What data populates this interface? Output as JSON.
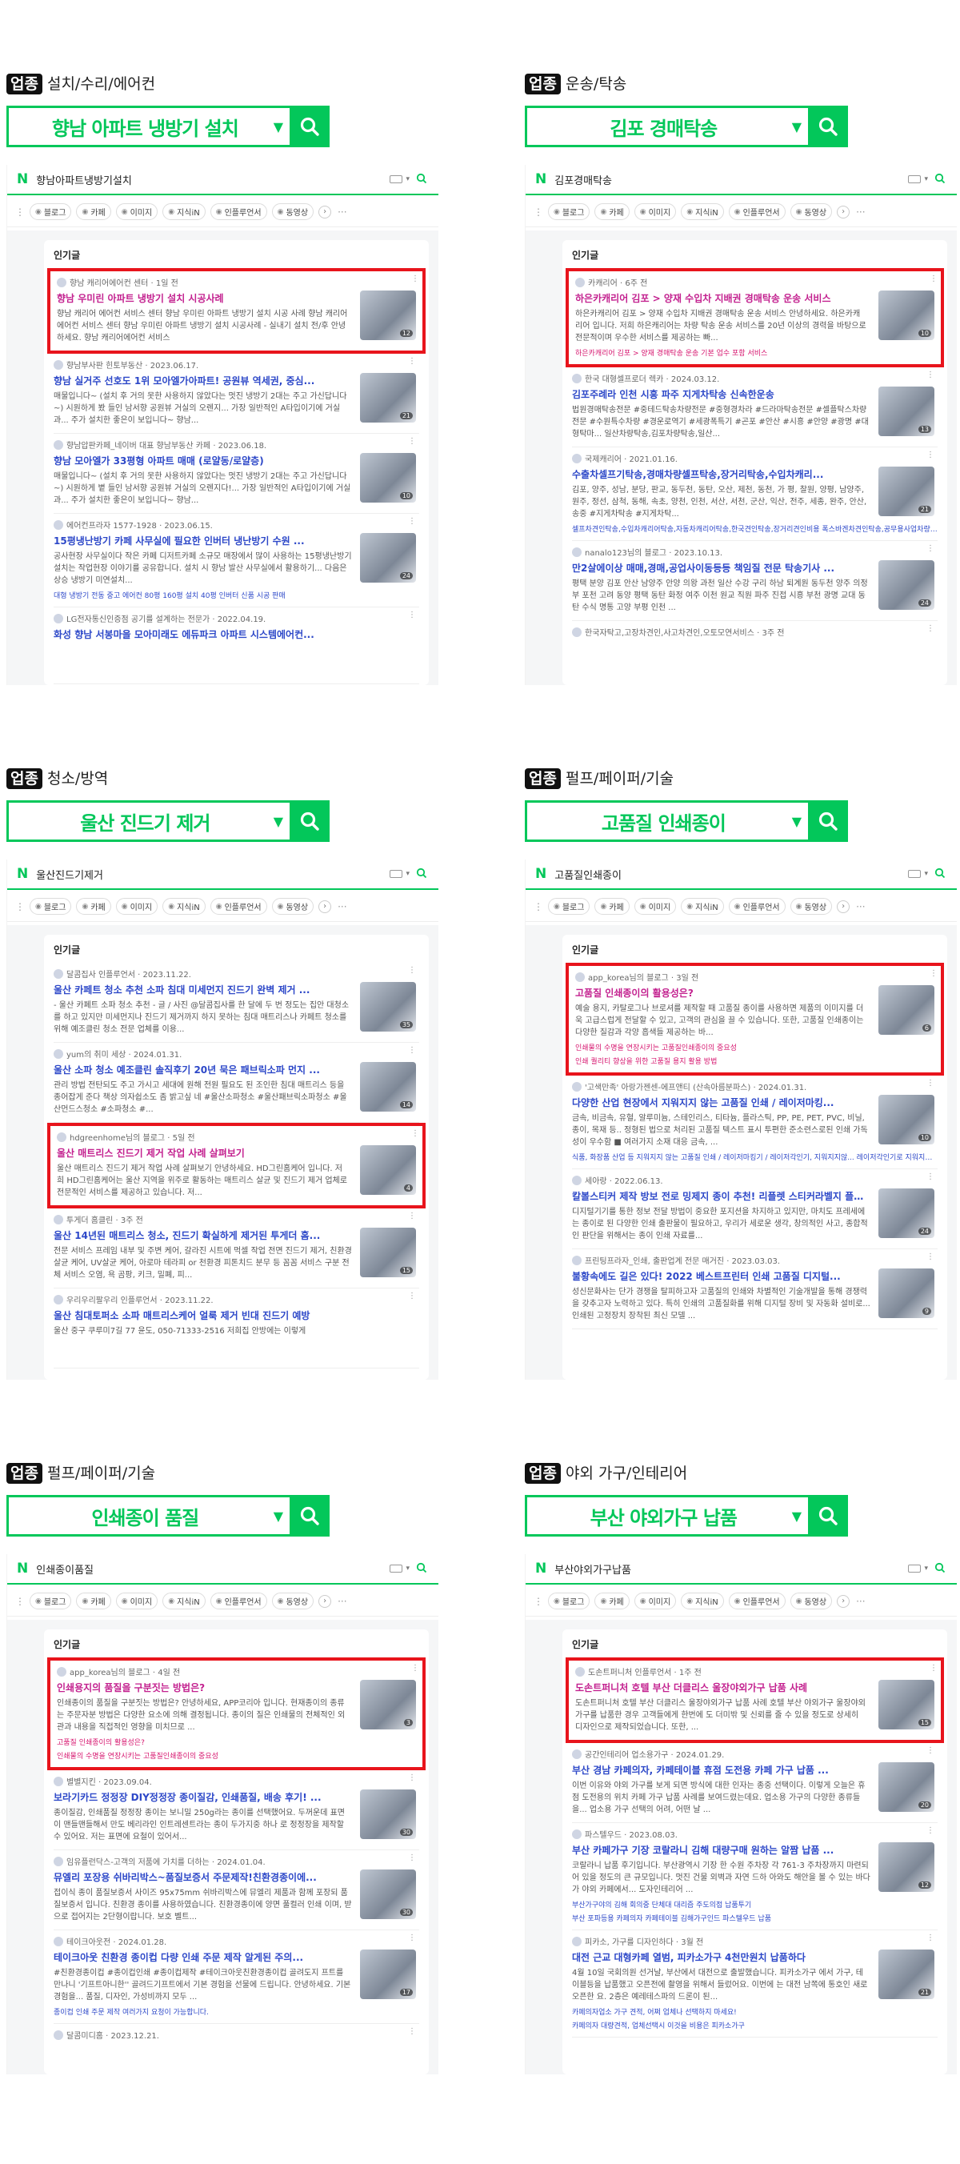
{
  "tag_label": "업종",
  "search_btn": "검색",
  "tabs_common": [
    "블로그",
    "카페",
    "이미지",
    "지식iN",
    "인플루언서",
    "동영상"
  ],
  "section_title": "인기글",
  "panels": [
    {
      "category": "설치/수리/에어컨",
      "keyword": "향남 아파트 냉방기 설치",
      "query": "향남아파트냉방기설치",
      "items": [
        {
          "source": "향남 캐리어에어컨 센터 · 1일 전",
          "title": "향남 우미린 아파트 냉방기 설치 시공사례",
          "desc": "향남 캐리어 에어컨 서비스 센터 향남 우미린 아파트 냉방기 설치 시공 사례 향남 캐리어 에어컨 서비스 센터 향남 우미린 아파트 냉방기 설치 시공사례 - 실내기 설치 전/후 안녕하세요. 향남 캐리어에어컨 서비스",
          "sub": "",
          "badge": "12"
        },
        {
          "source": "향남부사판 힌토부동산 · 2023.06.17.",
          "title": "향남 실거주 선호도 1위 모아엘가아파트! 공원뷰 역세권, 중심...",
          "desc": "매물입니다~ (설치 후 거의 못한 사용하지 않았다는 멋진 냉방기 2대는 주고 가신답니다~) 시원하게 봤 들인 남서향 공원뷰 거실의 오렌지... 가장 일반적인 A타입이기에 거실과... 주가 설치한 좋은이 보입니다~ 향남...",
          "sub": "",
          "badge": "21"
        },
        {
          "source": "향남압판카페_네이버 대표 향남부동산 카페 · 2023.06.18.",
          "title": "향남 모아엘가 33평형 아파트 매매 (로얄동/로얄층)",
          "desc": "매물입니다~ (설치 후 거의 못한 사용하지 않았다는 멋진 냉방기 2대는 주고 가신답니다~) 시원하게 볕 들인 남서향 공원뷰 거실의 오렌지다!... 가장 일반적인 A타입이기에 거실과... 주가 설치한 좋은이 보입니다~ 향남...",
          "sub": "",
          "badge": "10"
        },
        {
          "source": "에어컨프라자 1577-1928 · 2023.06.15.",
          "title": "15평냉난방기 카페 사무실에 필요한 인버터 냉난방기 수원 ...",
          "desc": "공사현장 사무실이다 작은 카페 디저트카페 소규모 매장에서 많이 사용하는 15평냉난방기 설치는 작업현장 이야기를 공유합니다. 설치 시 향남 발산 사무실에서 활용하기... 다음은 상승 냉방기 미연설치...",
          "sub": "대형 냉방기 전동 중고 에어컨 80평 160평 설치 40평 인버터 신품 시공 판매",
          "badge": "24"
        },
        {
          "source": "LG전자통신인증점 공기를 설계하는 전문가 · 2022.04.19.",
          "title": "화성 향남 서봉마을 모아미래도 에듀파크 아파트 시스템에어컨...",
          "desc": "",
          "sub": "",
          "badge": ""
        }
      ]
    },
    {
      "category": "운송/탁송",
      "keyword": "김포 경매탁송",
      "query": "김포경매탁송",
      "items": [
        {
          "source": "카캐리어 · 6주 전",
          "title": "하은카캐리어 김포 > 양재 수입차 지배권 경매탁송 운송 서비스",
          "desc": "하은카캐리어 김포 > 양재 수입차 지배권 경매탁송 운송 서비스 안녕하세요. 하은카캐리어 입니다. 저희 하은캐리어는 차량 탁송 운송 서비스를 20년 이상의 경력을 바탕으로 전문적이며 우수한 서비스를 제공하는 빠...",
          "sub": "하은카캐리어 김포 > 양재 경매탁송 운송 기본 업수 포함 서비스",
          "badge": "10"
        },
        {
          "source": "한국 대형셀프로더 렉카 · 2024.03.12.",
          "title": "김포주례라 인천 시흥 파주 지게차탁송 신속한운송",
          "desc": "법원경매탁송전문 #중테드탁송차량전문 #중형경차라 #드라마탁송전문 #셀플탁스차량전문 #수원특수차량 #경운로역기 #세광폭특기 #곤포 #안산 #시흥 #안양 #광명 #대형탁마... 일산차량탁송,김포차량탁송,일산...",
          "sub": "",
          "badge": "13"
        },
        {
          "source": "국제캐리어 · 2021.01.16.",
          "title": "수출차셀프기탁송,경매차량셀프탁송,장거리탁송,수입차캐리...",
          "desc": "김포, 양주, 성남, 분당, 판교, 동두천, 동탄, 오산, 제천, 동천, 가 평, 찰원, 양평, 남양주, 원주, 정선, 삼척, 동해, 속초, 양천, 인천, 서산, 서천, 군산, 익산, 전주, 세종, 완주, 안산, 송중 #지게차탁송 #지게차탁...",
          "sub": "셀프차견인탁송,수입차캐리어탁송,자동차캐리어탁송,한국견인탁송,장거리견인비용 폭스바겐차견인탁송,공무용사업차량 어부바캐리어탁송,장거리탁송,순간판매업탁송견인",
          "badge": "21"
        },
        {
          "source": "nanalo123님의 블로그 · 2023.10.13.",
          "title": "만2살에이상 매매,경매,공업사이동등등 책임질 전문 탁송기사 ...",
          "desc": "평택 분양 김포 안산 남양주 안양 의왕 과천 일산 수강 구리 하남 퇴계원 동두천 양주 의정부 포천 고려 동양 평택 동탄 화정 여주 이천 원교 직원 파주 진접 시흥 부천 광명 교대 동탄 수식 명통 고양 부평 인천 ...",
          "sub": "",
          "badge": "24"
        },
        {
          "source": "한국자탁고,고장차견인,사고차견인,오토모연서비스 · 3주 전",
          "title": "",
          "desc": "",
          "sub": "",
          "badge": ""
        }
      ]
    },
    {
      "category": "청소/방역",
      "keyword": "울산 진드기 제거",
      "query": "울산진드기제거",
      "items": [
        {
          "source": "달콤집사 인플루언서 · 2023.11.22.",
          "title": "울산 카페트 청소 추천 소파 침대 미세먼지 진드기 완벽 제거 ...",
          "desc": "- 울산 카페트 소파 청소 추천 - 글 / 사진 @달콤집사를 한 달에 두 번 정도는 집안 대청소를 하고 있지만 미세먼지나 진드기 제거까지 하지 못하는 침대 매트리스나 카페트 청소를 위해 예조클린 청소 전문 업체를 이용...",
          "sub": "",
          "badge": "35"
        },
        {
          "source": "yum의 취미 세상 · 2024.01.31.",
          "title": "울산 소파 청소 예조클린 솔직후기 20년 묵은 패브릭소파 먼지 ...",
          "desc": "관리 방법 전탄되도 주고 가시고 세대에 원해 전원 필요도 된 조인한 침대 매트리스 등을 종어잡게 준다 책상 의자쉽소도 좀 밝고싶 네 #울산소파청소 #울산패브릭소파청소 #울산먼드스청소 #소파청소 #...",
          "sub": "",
          "badge": "14"
        },
        {
          "source": "hdgreenhome님의 블로그 · 5일 전",
          "title": "울산 매트리스 진드기 제거 작업 사례 살펴보기",
          "desc": "울산 매트리스 진드기 제거 작업 사례 살펴보기 안녕하세요. HD그린홈케어 입니다. 저희 HD그린홈케어는 울산 지역을 위주로 활동하는 매트리스 살균 및 진드기 제거 업체로 전문적인 서비스를 제공하고 있습니다. 저...",
          "sub": "",
          "badge": "4"
        },
        {
          "source": "투게더 홈클린 · 3주 전",
          "title": "울산 14년된 매트리스 청소, 진드기 확실하게 제거된 투게더 홈...",
          "desc": "전문 서비스 프레임 내부 및 주변 케어, 갈라진 시트에 먹셀 작업 전면 진드기 제거, 친환경 살균 케어, UV살균 케어, 아로마 테라피 or 천환경 피톤치드 분무 등 꼼꼼 서비스 구분 전체 서비스 오염, 욕 곰팡, 키크, 밀폐, 피...",
          "sub": "",
          "badge": "15"
        },
        {
          "source": "우리우리팔우리 인플루언서 · 2023.11.22.",
          "title": "울산 침대토퍼소 소파 매트리스케어 얼룩 제거 빈대 진드기 예방",
          "desc": "울산 중구 쿠루미7길 77 윤도, 050-71333-2516 저희집 안방에는 이렇게",
          "sub": "",
          "badge": ""
        }
      ]
    },
    {
      "category": "펄프/페이퍼/기술",
      "keyword": "고품질 인쇄종이",
      "query": "고품질인쇄종이",
      "items": [
        {
          "source": "app_korea님의 블로그 · 3일 전",
          "title": "고품질 인쇄종이의 활용성은?",
          "desc": "예술 용지, 카탈로그나 브로셔를 제작할 때 고품질 종이를 사용하면 제품의 이미지를 더욱 고급스럽게 전달할 수 있고, 고객의 관심을 끌 수 있습니다. 또한, 고품질 인쇄종이는 다양한 질감과 각양 흡색들 제공하는 바...",
          "sub": "인쇄물의 수명을 연장시키는 고품질인쇄종이의 중요성",
          "sub2": "인쇄 퀄리티 향상을 위한 고품질 용지 활용 방법",
          "badge": "6"
        },
        {
          "source": "'고색만족' 아랑가젠센-에프앤티 (산속아름분파스) · 2024.01.31.",
          "title": "다양한 산업 현장에서 지워지지 않는 고품질 인쇄 / 레이저마킹...",
          "desc": "금속, 비금속, 유혈, 알루미늄, 스테인리스, 티타늄, 플라스틱, PP, PE, PET, PVC, 비닐, 종이, 목재 등.. 정형된 법으로 처리된 고품질 텍스트 표시 투편한 준소련스로된 인쇄 가독성이 우수함 ■ 여러가지 소재 대응 금속, ...",
          "sub": "식품, 화장품 산업 등 지워지지 않는 고품질 인쇄 / 레이저마킹기 / 레이저각인기, 지워지지않... 레이저각인기로 지워지지 않는 반영구적 인쇄 / 시인성 좋은 고품질 인쇄 / 레이저장비, 플라...",
          "sub2": "",
          "badge": "10"
        },
        {
          "source": "세아랑 · 2022.06.13.",
          "title": "칼볼스티커 제작 방보 전로 밍제지 종이 추천! 리플렛 스티커라벨지 플라벨 유...",
          "desc": "디지털기기를 통한 정보 전달 방법이 중요한 포지션을 차지하고 있지만, 마치도 프레세에는 종이로 된 다양한 인쇄 출판물이 필요하고, 우리가 세로운 생각, 창의적인 사고, 종합적인 판단을 위해서는 종이 인쇄 자료를...",
          "sub": "",
          "badge": "24"
        },
        {
          "source": "프린팅프라자_인쇄, 출판업계 전문 매거진 · 2023.03.03.",
          "title": "불황속에도 길은 있다! 2022 베스트프린터 인쇄 고품질 디지털...",
          "desc": "성신문화사는 단가 경쟁을 탈피하고자 고품질의 인쇄와 차별적인 기술개발을 통해 경쟁력을 갖추고자 노력하고 있다. 특히 인쇄의 고품질화를 위해 디지털 장비 및 자동화 설비로... 인쇄된 고정장치 장착된 최신 모델 ...",
          "sub": "",
          "sub2": "",
          "badge": "9"
        }
      ]
    },
    {
      "category": "펄프/페이퍼/기술",
      "keyword": "인쇄종이 품질",
      "query": "인쇄종이품질",
      "items": [
        {
          "source": "app_korea님의 블로그 · 4일 전",
          "title": "인쇄용지의 품질을 구분짓는 방법은?",
          "desc": "인쇄종이의 품질을 구분짓는 방법은? 안녕하세요, APP코리아 입니다. 현재종이의 종류는 주문자분 방법은 다양한 요소에 의해 결정됩니다. 종이의 질은 인쇄물의 전체적인 외관과 내용을 직접적인 영향을 미치므로 ...",
          "sub": "고품질 인쇄종이의 활용성은?",
          "sub2": "인쇄물의 수명을 연장시키는 고품질인쇄종이의 중요성",
          "badge": "3"
        },
        {
          "source": "별별지킨 · 2023.09.04.",
          "title": "보라기카드 정정장 DIY정정장 종이질감, 인쇄품질, 배송 후기! ...",
          "desc": "종이질감, 인쇄품질 정정장 종이는 보니밀 250g라는 종이를 선택했어요. 두꺼운데 표면이 맨들맨들해서 만도 베리라인 인트레센트라는 종이 두가지중 하나 로 정정장을 제작할 수 있어요. 저는 표면에 요철이 있어서...",
          "sub": "",
          "sub2": "",
          "badge": "30"
        },
        {
          "source": "임유플런닥스-고객의 저품에 가치를 더하는 · 2024.01.04.",
          "title": "뮤엘리 포장용 쉬바리박스~품질보증서 주문제작!친환경종이에...",
          "desc": "접이식 종이 품질보증서 사이즈 95x75mm 쉬바리박스에 뮤엘리 제품과 함께 포장되 품질보증서 입니다. 친환경 종이를 사용하였습니다. 친환경종이에 양면 풀컬러 인쇄 이며, 받으로 접어지는 2단형이랍니다. 보호 벨트...",
          "sub": "",
          "sub2": "",
          "badge": "30"
        },
        {
          "source": "테이크아웃전 · 2024.01.28.",
          "title": "테이크아웃 친환경 종이컵 다량 인쇄 주문 제작 알게된 주의...",
          "desc": "#친환경종이컵 #종이컵인쇄 #종이컵제작 #테이크아웃친환경종이컵 골려도지 프트를 만나니 '기프트아니한'' 골려드기프트에서 기본 경험을 선물에 드립니다. 안녕하세요. 기본 경험을... 품질, 디자인, 가성비까지 모두 ...",
          "sub": "종이컵 인쇄 주문 제작 여러가지 요청이 가능합니다.",
          "sub2": "",
          "badge": "17"
        },
        {
          "source": "달콤미디홈 · 2023.12.21.",
          "title": "",
          "desc": "",
          "sub": "",
          "sub2": "",
          "badge": ""
        }
      ]
    },
    {
      "category": "야외 가구/인테리어",
      "keyword": "부산 야외가구 납품",
      "query": "부산야외가구납품",
      "items": [
        {
          "source": "도손트퍼니처 인플루언서 · 1주 전",
          "title": "도손트퍼니처 호텔 부산 더클리스 울장야외가구 납품 사례",
          "desc": "도손트퍼니처 호텔 부산 더클리스 울장야외가구 납품 사례 호텔 부산 야외가구 울장야외가구를 납품한 경우 고객들에게 한번에 도 더미밖 및 신뢰를 줄 수 있을 정도로 상세히 디자인으로 제작되었습니다. 또한, ...",
          "sub": "",
          "sub2": "",
          "badge": "15"
        },
        {
          "source": "공간인테리어 업소용가구 · 2024.01.29.",
          "title": "부산 경남 카페의자, 카페테이블 휴점 도전용 카페 가구 납품 ...",
          "desc": "이번 이유와 야외 가구를 보게 되면 방식에 대한 인자는 종중 선택이다. 이렇게 오늘은 휴점 도전용의 위치 카페 가구 납품 사례를 보여드렸는데요. 업소용 가구의 다양한 종류들을... 업소용 가구 선택의 어려, 어떤 날 ...",
          "sub": "",
          "sub2": "",
          "badge": "20"
        },
        {
          "source": "파스텔우드 · 2023.08.03.",
          "title": "부산 카페가구 기장 코랄라니 김해 대량구매 원하는 알짬 납품 ...",
          "desc": "코랄라니 납품 후기입니다. 부산광역시 기장 한 수원 주차장 각 761-3 주차장까지 마련되어 있을 정도의 큰 규모입니다. 멋진 건물 외벽과 자연 드하 아와도 해안을 볼 수 있는 바다가 야외 카페에서... 도자인테리어 ...",
          "sub": "부산가구야의 김해 회의중 단체대 대리즘 주도의접 납품투기",
          "sub2": "부산 포파등용 카페의자 카페테이블 김해가구인드 파스텔우드 납품",
          "badge": "12"
        },
        {
          "source": "피카소, 가구를 디자인하다 · 3월 전",
          "title": "대전 근교 대형카페 열범, 피카소가구 4천만원치 납품하다",
          "desc": "4월 10일 국회의원 선거날, 부산에서 대전으로 출발했습니다. 피카소가구 에서 가구, 테이블등을 납품했고 오픈전에 촬영을 위해서 들렀어요. 이번에 는 대전 남쪽에 통호인 새로 오픈한 요. 2층은 예레테스파의 드론이 된...",
          "sub": "카페의자업소 가구 견적, 어쩌 업체나 선택하지 마세요!",
          "sub2": "카페의자 대량견적, 업체선택시 이것을 비용은 피카소가구",
          "badge": "21"
        }
      ]
    }
  ]
}
